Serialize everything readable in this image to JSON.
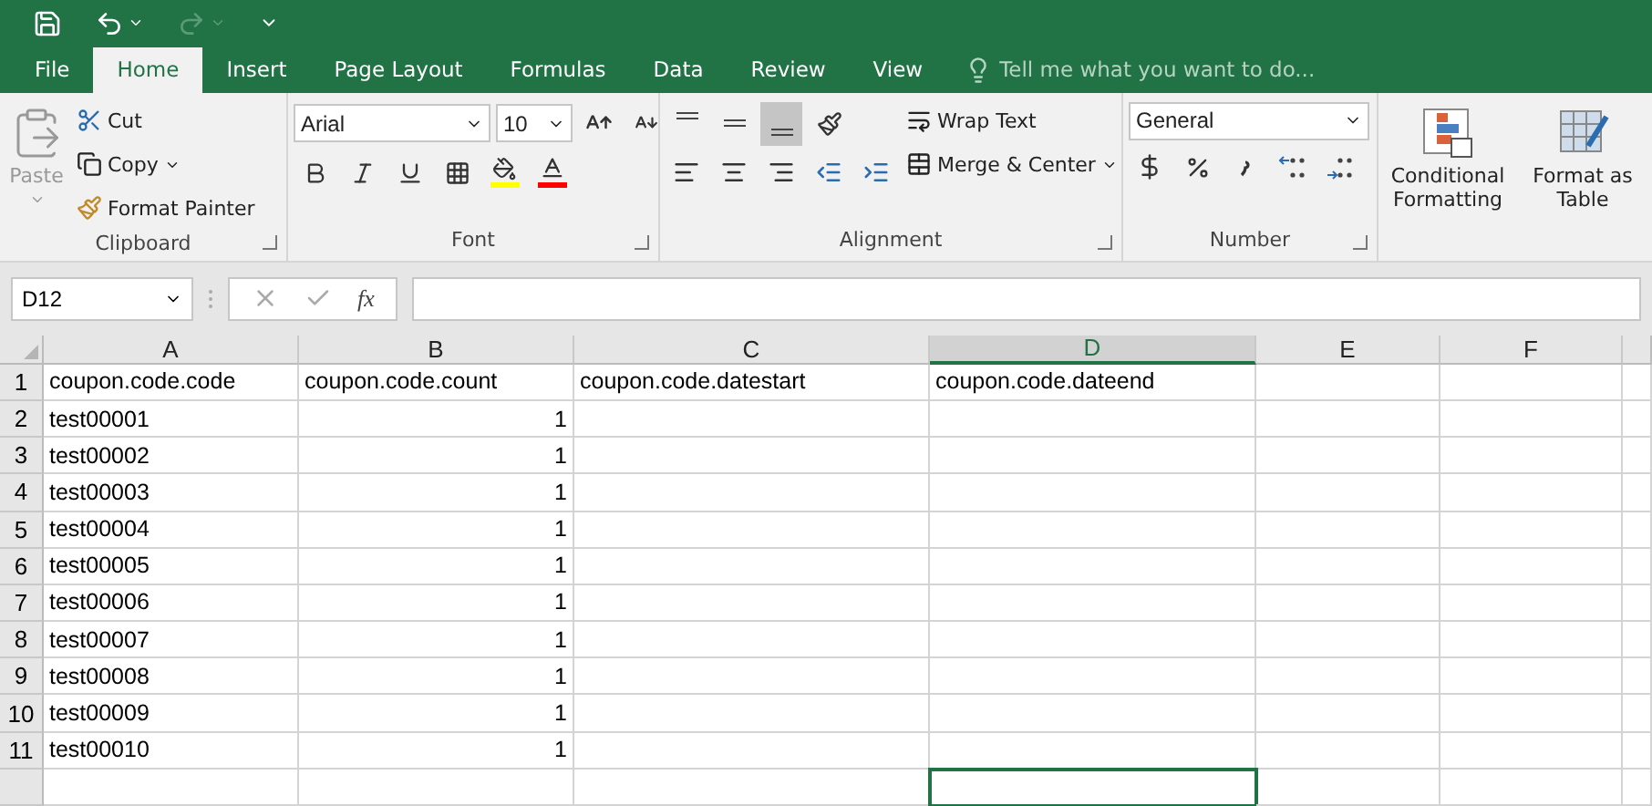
{
  "quick_access": {
    "undo_enabled": true,
    "redo_enabled": false
  },
  "tabs": [
    {
      "label": "File",
      "selected": false
    },
    {
      "label": "Home",
      "selected": true
    },
    {
      "label": "Insert",
      "selected": false
    },
    {
      "label": "Page Layout",
      "selected": false
    },
    {
      "label": "Formulas",
      "selected": false
    },
    {
      "label": "Data",
      "selected": false
    },
    {
      "label": "Review",
      "selected": false
    },
    {
      "label": "View",
      "selected": false
    }
  ],
  "tell_me": {
    "placeholder": "Tell me what you want to do..."
  },
  "ribbon": {
    "clipboard": {
      "title": "Clipboard",
      "paste": {
        "label": "Paste",
        "disabled": true
      },
      "cut": "Cut",
      "copy": "Copy",
      "format_painter": "Format Painter"
    },
    "font": {
      "title": "Font",
      "font_name": "Arial",
      "font_size": "10"
    },
    "alignment": {
      "title": "Alignment",
      "bottom_align_selected": true,
      "wrap_text": "Wrap Text",
      "merge_center": "Merge & Center"
    },
    "number": {
      "title": "Number",
      "format": "General"
    },
    "styles": {
      "conditional_formatting": "Conditional Formatting",
      "format_as_table": "Format as Table"
    }
  },
  "formula_bar": {
    "name_box": "D12",
    "fx": "fx"
  },
  "columns": [
    {
      "label": "A",
      "selected": false
    },
    {
      "label": "B",
      "selected": false
    },
    {
      "label": "C",
      "selected": false
    },
    {
      "label": "D",
      "selected": true
    },
    {
      "label": "E",
      "selected": false
    },
    {
      "label": "F",
      "selected": false
    }
  ],
  "rows": [
    {
      "number": "1",
      "cells": [
        {
          "text": "coupon.code.code",
          "kind": "text"
        },
        {
          "text": "coupon.code.count",
          "kind": "text"
        },
        {
          "text": "coupon.code.datestart",
          "kind": "text"
        },
        {
          "text": "coupon.code.dateend",
          "kind": "text"
        }
      ]
    },
    {
      "number": "2",
      "cells": [
        {
          "text": "test00001",
          "kind": "text"
        },
        {
          "text": "1",
          "kind": "number"
        }
      ]
    },
    {
      "number": "3",
      "cells": [
        {
          "text": "test00002",
          "kind": "text"
        },
        {
          "text": "1",
          "kind": "number"
        }
      ]
    },
    {
      "number": "4",
      "cells": [
        {
          "text": "test00003",
          "kind": "text"
        },
        {
          "text": "1",
          "kind": "number"
        }
      ]
    },
    {
      "number": "5",
      "cells": [
        {
          "text": "test00004",
          "kind": "text"
        },
        {
          "text": "1",
          "kind": "number"
        }
      ]
    },
    {
      "number": "6",
      "cells": [
        {
          "text": "test00005",
          "kind": "text"
        },
        {
          "text": "1",
          "kind": "number"
        }
      ]
    },
    {
      "number": "7",
      "cells": [
        {
          "text": "test00006",
          "kind": "text"
        },
        {
          "text": "1",
          "kind": "number"
        }
      ]
    },
    {
      "number": "8",
      "cells": [
        {
          "text": "test00007",
          "kind": "text"
        },
        {
          "text": "1",
          "kind": "number"
        }
      ]
    },
    {
      "number": "9",
      "cells": [
        {
          "text": "test00008",
          "kind": "text"
        },
        {
          "text": "1",
          "kind": "number"
        }
      ]
    },
    {
      "number": "10",
      "cells": [
        {
          "text": "test00009",
          "kind": "text"
        },
        {
          "text": "1",
          "kind": "number"
        }
      ]
    },
    {
      "number": "11",
      "cells": [
        {
          "text": "test00010",
          "kind": "text"
        },
        {
          "text": "1",
          "kind": "number"
        }
      ]
    }
  ]
}
